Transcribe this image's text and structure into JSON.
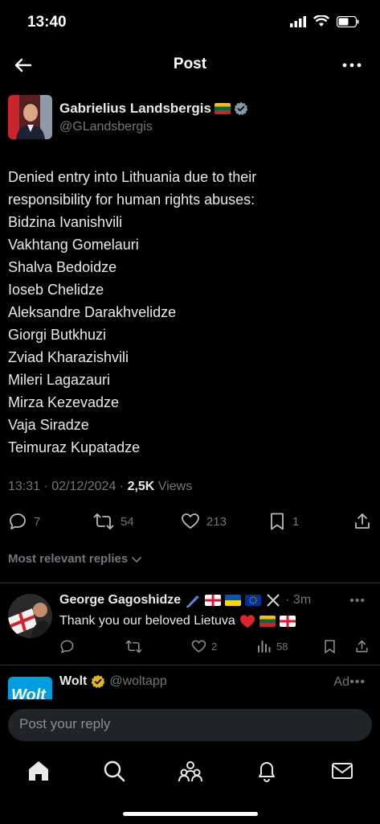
{
  "status_bar": {
    "time": "13:40"
  },
  "nav": {
    "title": "Post"
  },
  "post": {
    "author_name": "Gabrielius Landsbergis",
    "author_handle": "@GLandsbergis",
    "lines": [
      "Denied entry into Lithuania due to their",
      "responsibility for human rights abuses:",
      "Bidzina Ivanishvili",
      "Vakhtang Gomelauri",
      "Shalva Bedoidze",
      "Ioseb Chelidze",
      "Aleksandre Darakhvelidze",
      "Giorgi Butkhuzi",
      "Zviad Kharazishvili",
      "Mileri Lagazauri",
      "Mirza Kezevadze",
      "Vaja Siradze",
      "Teimuraz Kupatadze"
    ],
    "timestamp": "13:31 · 02/12/2024 · ",
    "views_count": "2,5K",
    "views_label": " Views",
    "replies": "7",
    "reposts": "54",
    "likes": "213",
    "bookmarks": "1"
  },
  "replies_sort_label": "Most relevant replies",
  "reply1": {
    "name": "George Gagoshidze",
    "time": "· 3m",
    "text": "Thank you our beloved Lietuva",
    "likes": "2",
    "views": "58"
  },
  "ad": {
    "name": "Wolt",
    "handle": "@woltapp",
    "label": "Ad",
    "avatar_text": "Wolt"
  },
  "composer": {
    "placeholder": "Post your reply"
  },
  "colors": {
    "background": "#000000",
    "text": "#e7e9ea",
    "muted": "#71767b",
    "divider": "#2f3336",
    "verified": "#829aab",
    "wolt_blue": "#009de0",
    "heart": "#f91880"
  }
}
